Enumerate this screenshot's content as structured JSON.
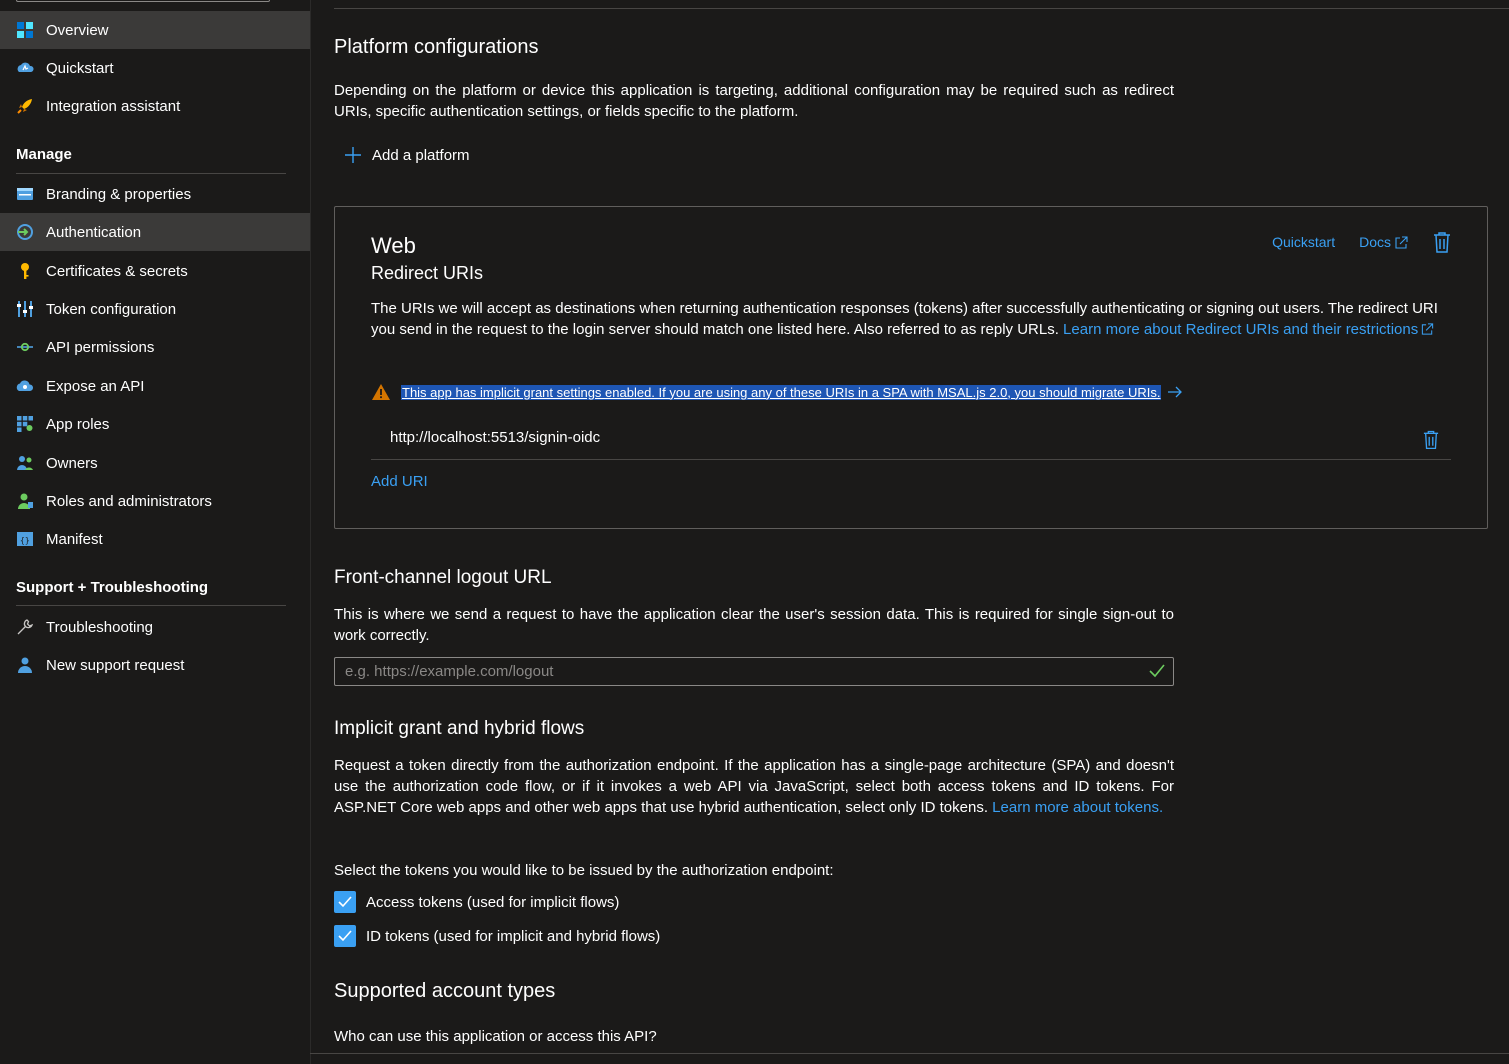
{
  "sidebar": {
    "items": [
      {
        "label": "Overview",
        "icon": "overview-icon"
      },
      {
        "label": "Quickstart",
        "icon": "quickstart-icon"
      },
      {
        "label": "Integration assistant",
        "icon": "rocket-icon"
      }
    ],
    "manage_title": "Manage",
    "manage_items": [
      {
        "label": "Branding & properties",
        "icon": "branding-icon"
      },
      {
        "label": "Authentication",
        "icon": "authentication-icon"
      },
      {
        "label": "Certificates & secrets",
        "icon": "key-icon"
      },
      {
        "label": "Token configuration",
        "icon": "token-config-icon"
      },
      {
        "label": "API permissions",
        "icon": "api-permissions-icon"
      },
      {
        "label": "Expose an API",
        "icon": "cloud-icon"
      },
      {
        "label": "App roles",
        "icon": "app-roles-icon"
      },
      {
        "label": "Owners",
        "icon": "owners-icon"
      },
      {
        "label": "Roles and administrators",
        "icon": "roles-admins-icon"
      },
      {
        "label": "Manifest",
        "icon": "manifest-icon"
      }
    ],
    "support_title": "Support + Troubleshooting",
    "support_items": [
      {
        "label": "Troubleshooting",
        "icon": "wrench-icon"
      },
      {
        "label": "New support request",
        "icon": "support-person-icon"
      }
    ],
    "selected": "Authentication"
  },
  "main": {
    "platform_title": "Platform configurations",
    "platform_desc": "Depending on the platform or device this application is targeting, additional configuration may be required such as redirect URIs, specific authentication settings, or fields specific to the platform.",
    "add_platform": "Add a platform",
    "web_card": {
      "title": "Web",
      "subtitle": "Redirect URIs",
      "quickstart": "Quickstart",
      "docs": "Docs",
      "desc": "The URIs we will accept as destinations when returning authentication responses (tokens) after successfully authenticating or signing out users. The redirect URI you send in the request to the login server should match one listed here. Also referred to as reply URLs. ",
      "desc_link": "Learn more about Redirect URIs and their restrictions",
      "warning": "This app has implicit grant settings enabled. If you are using any of these URIs in a SPA with MSAL.js 2.0, you should migrate URIs.",
      "uri": "http://localhost:5513/signin-oidc",
      "add_uri": "Add URI"
    },
    "logout_title": "Front-channel logout URL",
    "logout_desc": "This is where we send a request to have the application clear the user's session data. This is required for single sign-out to work correctly.",
    "logout_placeholder": "e.g. https://example.com/logout",
    "implicit_title": "Implicit grant and hybrid flows",
    "implicit_desc": "Request a token directly from the authorization endpoint. If the application has a single-page architecture (SPA) and doesn't use the authorization code flow, or if it invokes a web API via JavaScript, select both access tokens and ID tokens. For ASP.NET Core web apps and other web apps that use hybrid authentication, select only ID tokens. ",
    "implicit_link": "Learn more about tokens.",
    "select_tokens": "Select the tokens you would like to be issued by the authorization endpoint:",
    "access_tokens": "Access tokens (used for implicit flows)",
    "id_tokens": "ID tokens (used for implicit and hybrid flows)",
    "access_checked": true,
    "id_checked": true,
    "account_types_title": "Supported account types",
    "account_types_q": "Who can use this application or access this API?"
  },
  "colors": {
    "background": "#1b1a19",
    "selected": "#3b3a39",
    "link": "#3aa0f3",
    "warning": "#d47500",
    "success": "#6ccb5f"
  }
}
